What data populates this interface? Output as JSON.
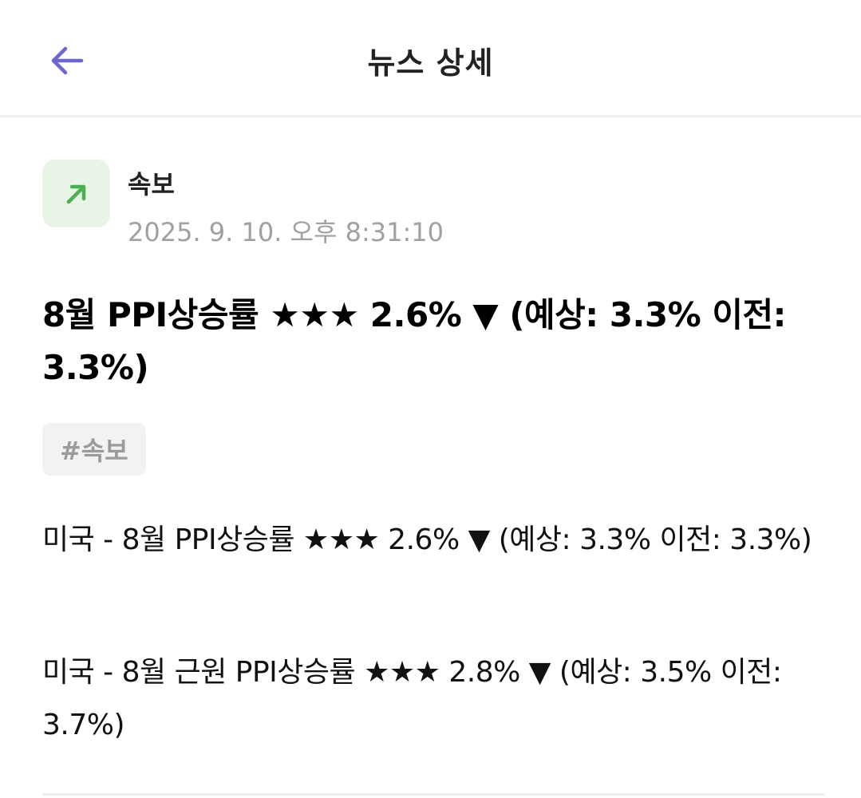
{
  "header": {
    "title": "뉴스 상세",
    "back_icon": "arrow-left-icon",
    "back_color": "#6b67cf"
  },
  "source": {
    "icon": "trending-up-arrow-icon",
    "icon_color": "#4caf50",
    "name": "속보",
    "timestamp": "2025. 9. 10. 오후 8:31:10"
  },
  "article": {
    "title": "8월 PPI상승률 ★★★ 2.6% ▼ (예상: 3.3% 이전: 3.3%)",
    "tag": "#속보",
    "paragraphs": [
      "미국 - 8월 PPI상승률 ★★★ 2.6% ▼ (예상: 3.3% 이전: 3.3%)",
      "미국 - 8월 근원 PPI상승률 ★★★ 2.8% ▼ (예상: 3.5% 이전: 3.7%)"
    ]
  }
}
